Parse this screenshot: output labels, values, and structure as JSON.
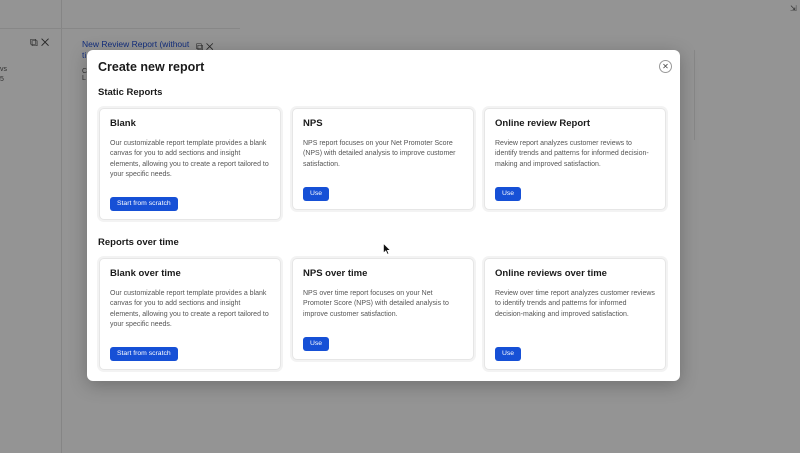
{
  "background": {
    "text_a": "vs",
    "text_b": "5",
    "link_title": "New Review Report (without ti",
    "sub_text_a": "C",
    "sub_text_b": "L"
  },
  "modal": {
    "title": "Create new report",
    "close_glyph": "✕",
    "sections": [
      {
        "title": "Static Reports",
        "cards": [
          {
            "title": "Blank",
            "description": "Our customizable report template provides a blank canvas for you to add sections and insight elements, allowing you to create a report tailored to your specific needs.",
            "button": "Start from scratch"
          },
          {
            "title": "NPS",
            "description": "NPS report focuses on your Net Promoter Score (NPS) with detailed analysis to improve customer satisfaction.",
            "button": "Use"
          },
          {
            "title": "Online review Report",
            "description": "Review report analyzes customer reviews to identify trends and patterns for informed decision-making and improved satisfaction.",
            "button": "Use"
          }
        ]
      },
      {
        "title": "Reports over time",
        "cards": [
          {
            "title": "Blank over time",
            "description": "Our customizable report template provides a blank canvas for you to add sections and insight elements, allowing you to create a report tailored to your specific needs.",
            "button": "Start from scratch"
          },
          {
            "title": "NPS over time",
            "description": "NPS over time report focuses on your Net Promoter Score (NPS) with detailed analysis to improve customer satisfaction.",
            "button": "Use"
          },
          {
            "title": "Online reviews over time",
            "description": "Review over time report analyzes customer reviews to identify trends and patterns for informed decision-making and improved satisfaction.",
            "button": "Use"
          }
        ]
      }
    ]
  },
  "colors": {
    "accent": "#1650d6",
    "overlay": "#6b6b6b"
  }
}
